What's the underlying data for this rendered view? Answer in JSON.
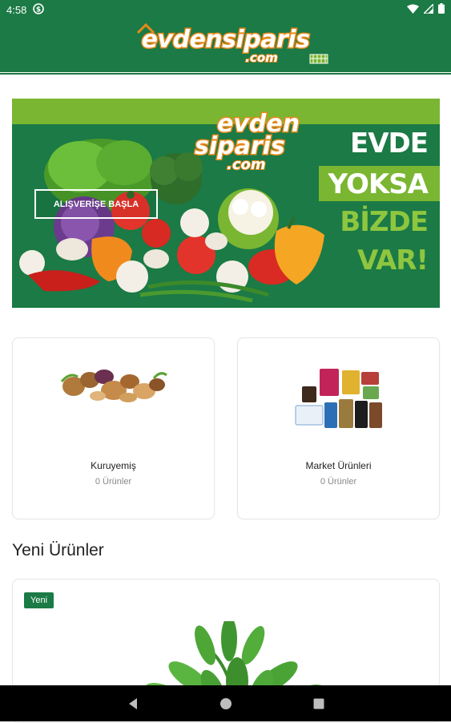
{
  "status_bar": {
    "time": "4:58"
  },
  "app_bar": {
    "logo_text": "evdensiparis",
    "logo_domain": ".com"
  },
  "banner": {
    "logo_line1": "evden",
    "logo_line2": "siparis",
    "logo_line3": ".com",
    "slogan_line1": "EVDE",
    "slogan_line2": "YOKSA",
    "slogan_line3": "BİZDE",
    "slogan_line4": "VAR!",
    "cta_label": "ALIŞVERİŞE BAŞLA"
  },
  "categories": [
    {
      "title": "Kuruyemiş",
      "count": "0 Ürünler"
    },
    {
      "title": "Market Ürünleri",
      "count": "0 Ürünler"
    }
  ],
  "new_products": {
    "section_title": "Yeni Ürünler",
    "badge": "Yeni"
  },
  "colors": {
    "brand_green": "#1b7a45",
    "light_green": "#7ab631",
    "logo_orange": "#e8891b"
  },
  "icons": [
    "app-notification-icon",
    "wifi-icon",
    "signal-icon",
    "battery-icon",
    "back-icon",
    "home-icon",
    "recents-icon"
  ]
}
